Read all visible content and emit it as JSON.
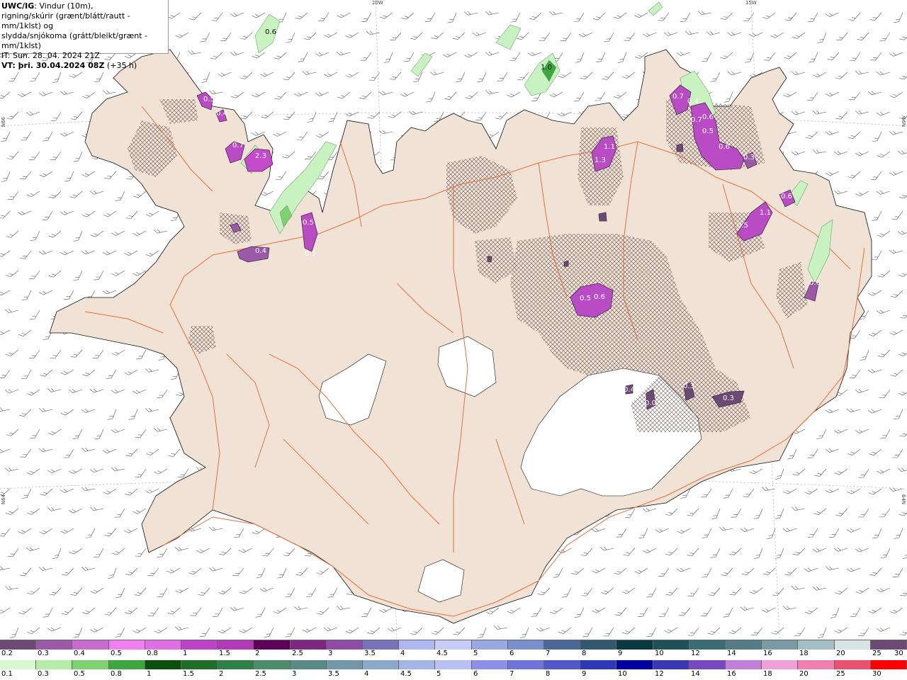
{
  "header": {
    "model": "UWC/IG",
    "line1_rest": ": Vindur (10m),",
    "line2": "rigning/skúrir (grænt/blátt/rautt - mm/1klst) og",
    "line3": "slydda/snjókoma (grátt/bleikt/grænt - mm/1klst)",
    "line4": "IT: Sun. 28. 04. 2024 21Z",
    "vt_label": "VT: þri. 30.04.2024 08Z",
    "vt_rest": " (+35 h)"
  },
  "grid_labels": {
    "top_20w": "20W",
    "top_15w": "15W",
    "left_66n": "N66",
    "left_64n": "N64",
    "right_66n": "66N",
    "right_64n": "64N"
  },
  "precip_labels": [
    "0.6",
    "1.0",
    "0.5",
    "0.4",
    "0.7",
    "2.3",
    "0.5",
    "0.5",
    "0.4",
    "1.1",
    "1.3",
    "0.7",
    "0.4",
    "0.6",
    "0.7",
    "0.5",
    "0.6",
    "0.3",
    "0.5",
    "1.1",
    "0.6",
    "0.5",
    "0.6",
    "0.6",
    "0.4",
    "0.0",
    "0.3",
    "0.3"
  ],
  "colors": {
    "land": "#f0e2d4",
    "snow_sleet_scale": [
      "#6b4a73",
      "#9a5aa8",
      "#c66ccc",
      "#f07ff0",
      "#e06fe6",
      "#bb44c8",
      "#b03ab8",
      "#5c0058",
      "#7c287e",
      "#8e4ea6",
      "#7a72b8",
      "#b0b8f0",
      "#c8ccf4",
      "#9aa8e0",
      "#7a90cc",
      "#4c6896",
      "#345870",
      "#0a3a40",
      "#1e5258",
      "#3a6c74",
      "#557c84",
      "#7a9aa4",
      "#a4bec4",
      "#d8e4e4"
    ],
    "rain_scale": [
      "#d8f8d0",
      "#b4eca8",
      "#7ed070",
      "#3ea640",
      "#0b4f0a",
      "#1e6e26",
      "#2e8048",
      "#4a8c68",
      "#5a8a86",
      "#7298a8",
      "#8aa8c8",
      "#a4b4e4",
      "#b8c0f4",
      "#8c90e8",
      "#6e74d8",
      "#5058c8",
      "#2d3ab8",
      "#0000a0",
      "#3838b4",
      "#7848c0",
      "#c080d8",
      "#f0a0d8",
      "#f080b0",
      "#e85070",
      "#ff0000"
    ],
    "roads": "#e8703a"
  },
  "legend_snow": {
    "labels": [
      "0.2",
      "0.3",
      "0.4",
      "0.5",
      "0.8",
      "1",
      "1.5",
      "2",
      "2.5",
      "3",
      "3.5",
      "4",
      "4.5",
      "5",
      "6",
      "7",
      "8",
      "9",
      "10",
      "12",
      "14",
      "16",
      "18",
      "20",
      "25",
      "30"
    ]
  },
  "legend_rain": {
    "labels": [
      "0.1",
      "0.3",
      "0.5",
      "0.8",
      "1",
      "1.5",
      "2",
      "2.5",
      "3",
      "3.5",
      "4",
      "4.5",
      "5",
      "6",
      "7",
      "8",
      "9",
      "10",
      "12",
      "14",
      "16",
      "18",
      "20",
      "25",
      "30"
    ]
  }
}
